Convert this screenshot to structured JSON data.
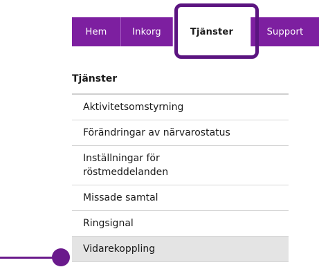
{
  "tabs": [
    {
      "label": "Hem"
    },
    {
      "label": "Inkorg"
    },
    {
      "label": "Tjänster"
    },
    {
      "label": "Support"
    }
  ],
  "active_tab": "Tjänster",
  "section_title": "Tjänster",
  "menu_items": [
    {
      "label": "Aktivitetsomstyrning"
    },
    {
      "label": "Förändringar av närvarostatus"
    },
    {
      "label": "Inställningar för röstmeddelanden"
    },
    {
      "label": "Missade samtal"
    },
    {
      "label": "Ringsignal"
    },
    {
      "label": "Vidarekoppling"
    }
  ],
  "selected_item": "Vidarekoppling",
  "colors": {
    "tab_bar": "#7d1fa0",
    "highlight": "#5b1480",
    "pointer": "#6a1a8c",
    "selected_row": "#e4e4e4"
  }
}
